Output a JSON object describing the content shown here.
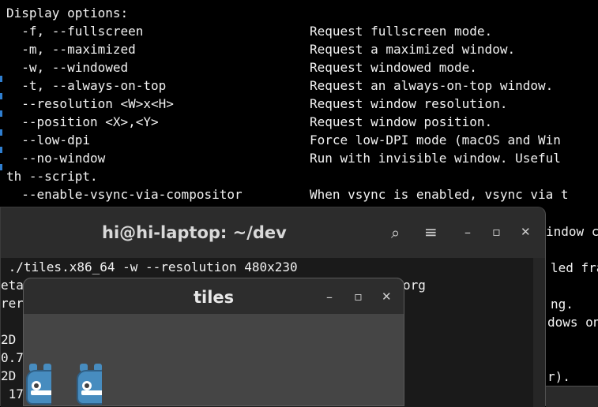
{
  "background_terminal": {
    "lines": [
      "Display options:",
      "  -f, --fullscreen",
      "  -m, --maximized",
      "  -w, --windowed",
      "  -t, --always-on-top",
      "  --resolution <W>x<H>",
      "  --position <X>,<Y>",
      "  --low-dpi",
      "  --no-window",
      "th --script.",
      "  --enable-vsync-via-compositor"
    ],
    "descriptions": [
      "",
      "Request fullscreen mode.",
      "Request a maximized window.",
      "Request windowed mode.",
      "Request an always-on-top window.",
      "Request window resolution.",
      "Request window position.",
      "Force low-DPI mode (macOS and Win",
      "Run with invisible window. Useful",
      "",
      "When vsync is enabled, vsync via t"
    ],
    "right_fragments": [
      "indow c",
      "led fra",
      "ng.",
      "dows on",
      "r)."
    ]
  },
  "terminal_window": {
    "title": "hi@hi-laptop: ~/dev",
    "icons": {
      "search": "search-icon",
      "menu": "hamburger-menu-icon",
      "minimize": "minimize-icon",
      "maximize": "maximize-icon",
      "close": "close-icon"
    },
    "glyphs": {
      "search": "⌕",
      "menu": "≡",
      "minimize": "–",
      "maximize": "▫",
      "close": "✕"
    },
    "lines": [
      " ./tiles.x86_64 -w --resolution 480x230",
      "eta",
      "rer",
      "",
      "2D",
      "0.7",
      "2D",
      " 17"
    ],
    "hidden_fragment": "org"
  },
  "tiles_window": {
    "title": "tiles",
    "glyphs": {
      "minimize": "–",
      "maximize": "▫",
      "close": "✕"
    }
  },
  "colors": {
    "godot_blue": "#478cbf",
    "background": "#000000",
    "titlebar": "#2c2c2c"
  }
}
